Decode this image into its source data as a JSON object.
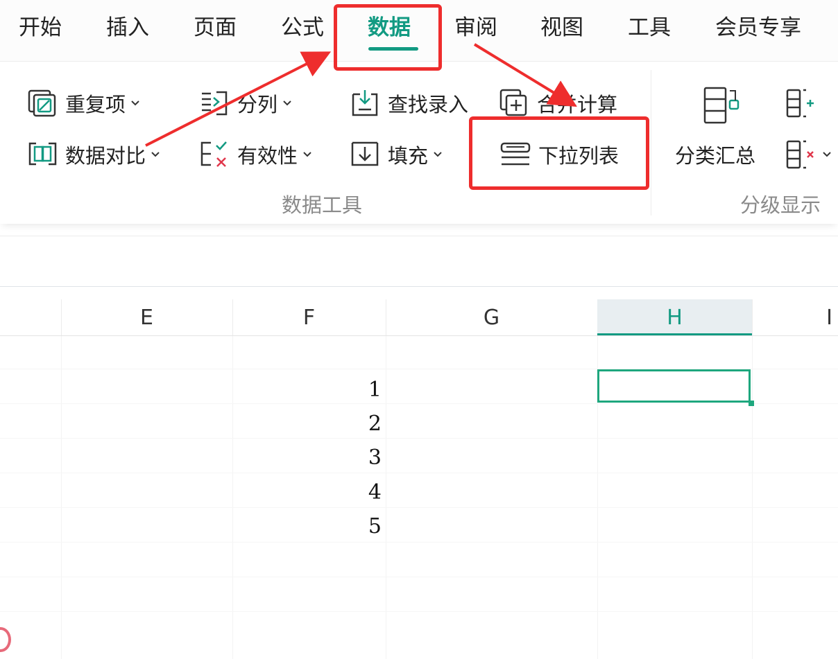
{
  "menu": {
    "tabs": [
      {
        "label": "开始"
      },
      {
        "label": "插入"
      },
      {
        "label": "页面"
      },
      {
        "label": "公式"
      },
      {
        "label": "数据",
        "active": true
      },
      {
        "label": "审阅"
      },
      {
        "label": "视图"
      },
      {
        "label": "工具"
      },
      {
        "label": "会员专享"
      }
    ]
  },
  "ribbon": {
    "data_tools": {
      "label": "数据工具",
      "buttons": {
        "duplicates": {
          "label": "重复项",
          "icon": "duplicates-icon"
        },
        "split_column": {
          "label": "分列",
          "icon": "split-column-icon"
        },
        "lookup_entry": {
          "label": "查找录入",
          "icon": "lookup-entry-icon"
        },
        "consolidate": {
          "label": "合并计算",
          "icon": "consolidate-icon"
        },
        "data_compare": {
          "label": "数据对比",
          "icon": "data-compare-icon"
        },
        "validity": {
          "label": "有效性",
          "icon": "validity-icon"
        },
        "fill": {
          "label": "填充",
          "icon": "fill-icon"
        },
        "dropdown_list": {
          "label": "下拉列表",
          "icon": "dropdown-list-icon"
        }
      }
    },
    "outline": {
      "label": "分级显示",
      "buttons": {
        "subtotal": {
          "label": "分类汇总",
          "icon": "subtotal-icon"
        },
        "group": {
          "icon": "group-icon"
        },
        "ungroup": {
          "icon": "ungroup-icon"
        }
      }
    }
  },
  "sheet": {
    "columns": [
      "E",
      "F",
      "G",
      "H",
      "I"
    ],
    "selected_column": "H",
    "cells_F": [
      "1",
      "2",
      "3",
      "4",
      "5"
    ]
  },
  "colors": {
    "accent": "#129a82",
    "selection": "#1ea77e",
    "annotation": "#ee2d2d"
  }
}
